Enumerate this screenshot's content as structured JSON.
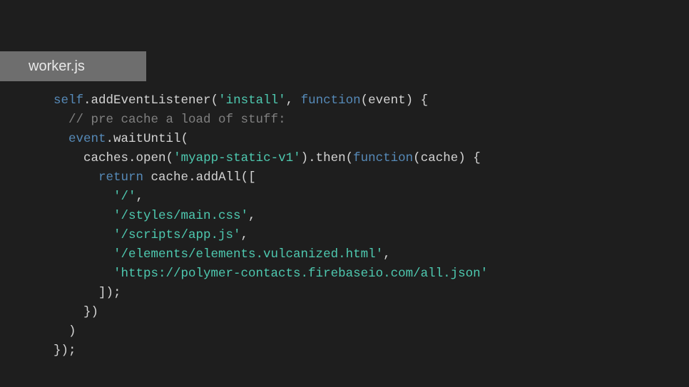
{
  "tab": {
    "filename": "worker.js"
  },
  "code": {
    "line1": {
      "self": "self",
      "dot1": ".",
      "addEventListener": "addEventListener",
      "paren1": "(",
      "install": "'install'",
      "comma": ", ",
      "function": "function",
      "paren2": "(",
      "event": "event",
      "paren3": ") {"
    },
    "line2": {
      "indent": "  ",
      "comment": "// pre cache a load of stuff:"
    },
    "line3": {
      "indent": "  ",
      "event": "event",
      "dot": ".",
      "waitUntil": "waitUntil",
      "paren": "("
    },
    "line4": {
      "indent": "    ",
      "caches": "caches",
      "dot1": ".",
      "open": "open",
      "paren1": "(",
      "str": "'myapp-static-v1'",
      "paren2": ").",
      "then": "then",
      "paren3": "(",
      "function": "function",
      "paren4": "(",
      "cache": "cache",
      "paren5": ") {"
    },
    "line5": {
      "indent": "      ",
      "return": "return",
      "space": " ",
      "cache": "cache",
      "dot": ".",
      "addAll": "addAll",
      "paren": "(["
    },
    "line6": {
      "indent": "        ",
      "str": "'/'",
      "comma": ","
    },
    "line7": {
      "indent": "        ",
      "str": "'/styles/main.css'",
      "comma": ","
    },
    "line8": {
      "indent": "        ",
      "str": "'/scripts/app.js'",
      "comma": ","
    },
    "line9": {
      "indent": "        ",
      "str": "'/elements/elements.vulcanized.html'",
      "comma": ","
    },
    "line10": {
      "indent": "        ",
      "str": "'https://polymer-contacts.firebaseio.com/all.json'"
    },
    "line11": {
      "indent": "      ",
      "close": "]);"
    },
    "line12": {
      "indent": "    ",
      "close": "})"
    },
    "line13": {
      "indent": "  ",
      "close": ")"
    },
    "line14": {
      "close": "});"
    }
  }
}
